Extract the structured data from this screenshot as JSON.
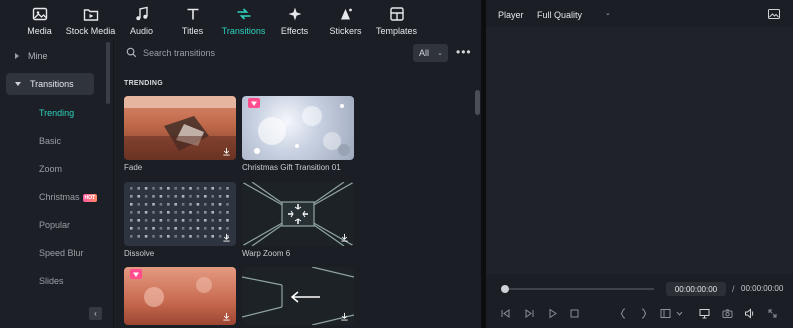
{
  "toolbar": {
    "items": [
      {
        "label": "Media",
        "icon": "media-icon"
      },
      {
        "label": "Stock Media",
        "icon": "stock-media-icon"
      },
      {
        "label": "Audio",
        "icon": "music-note-icon"
      },
      {
        "label": "Titles",
        "icon": "text-t-icon"
      },
      {
        "label": "Transitions",
        "icon": "transitions-icon",
        "active": true
      },
      {
        "label": "Effects",
        "icon": "effects-sparkle-icon"
      },
      {
        "label": "Stickers",
        "icon": "stickers-icon"
      },
      {
        "label": "Templates",
        "icon": "templates-icon"
      }
    ]
  },
  "sidebar": {
    "mine": "Mine",
    "transitions": "Transitions",
    "subitems": [
      "Trending",
      "Basic",
      "Zoom",
      "Christmas",
      "Popular",
      "Speed Blur",
      "Slides"
    ],
    "hot_badge": "HOT"
  },
  "search": {
    "placeholder": "Search transitions",
    "filter": "All"
  },
  "section_title": "TRENDING",
  "cards": [
    {
      "label": "Fade"
    },
    {
      "label": "Christmas Gift Transition 01"
    },
    {
      "label": "Dissolve"
    },
    {
      "label": "Warp Zoom 6"
    },
    {
      "label": ""
    },
    {
      "label": ""
    }
  ],
  "player": {
    "label": "Player",
    "quality": "Full Quality",
    "current_time": "00:00:00:00",
    "separator": "/",
    "total_time": "00:00:00:00"
  },
  "colors": {
    "accent": "#2dd4bf",
    "premium": "#ff4d8d",
    "hot": "#ff6a8a"
  }
}
